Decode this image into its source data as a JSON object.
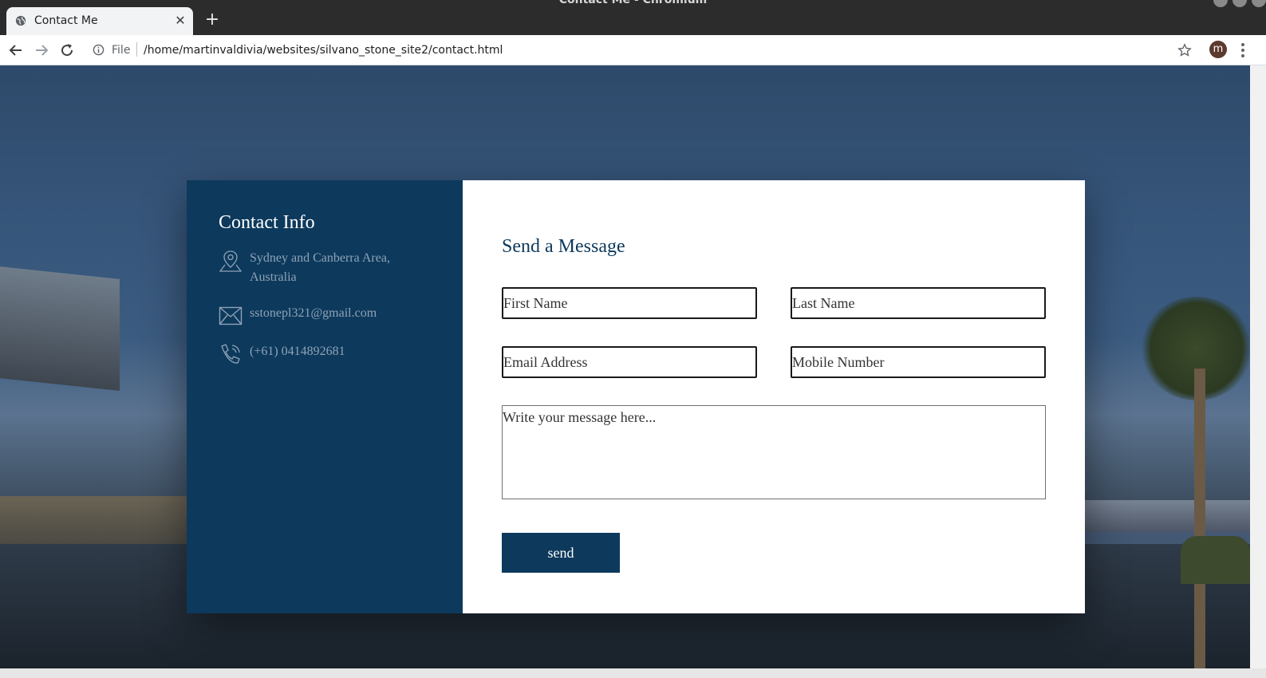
{
  "window": {
    "title": "Contact Me - Chromium"
  },
  "tab": {
    "title": "Contact Me",
    "close_symbol": "✕",
    "new_tab_symbol": "+"
  },
  "toolbar": {
    "url_scheme": "File",
    "url": "/home/martinvaldivia/websites/silvano_stone_site2/contact.html",
    "profile_initial": "m"
  },
  "contact_info": {
    "title": "Contact Info",
    "items": [
      {
        "icon": "location-pin-icon",
        "text": "Sydney and Canberra Area, Australia"
      },
      {
        "icon": "envelope-icon",
        "text": "sstonepl321@gmail.com"
      },
      {
        "icon": "phone-icon",
        "text": "(+61) 0414892681"
      }
    ]
  },
  "form": {
    "title": "Send a Message",
    "first_name_placeholder": "First Name",
    "last_name_placeholder": "Last Name",
    "email_placeholder": "Email Address",
    "mobile_placeholder": "Mobile Number",
    "message_placeholder": "Write your message here...",
    "send_label": "send"
  },
  "colors": {
    "panel_blue": "#0d395c",
    "info_text": "#8ea3b7",
    "form_bg": "#ffffff"
  }
}
